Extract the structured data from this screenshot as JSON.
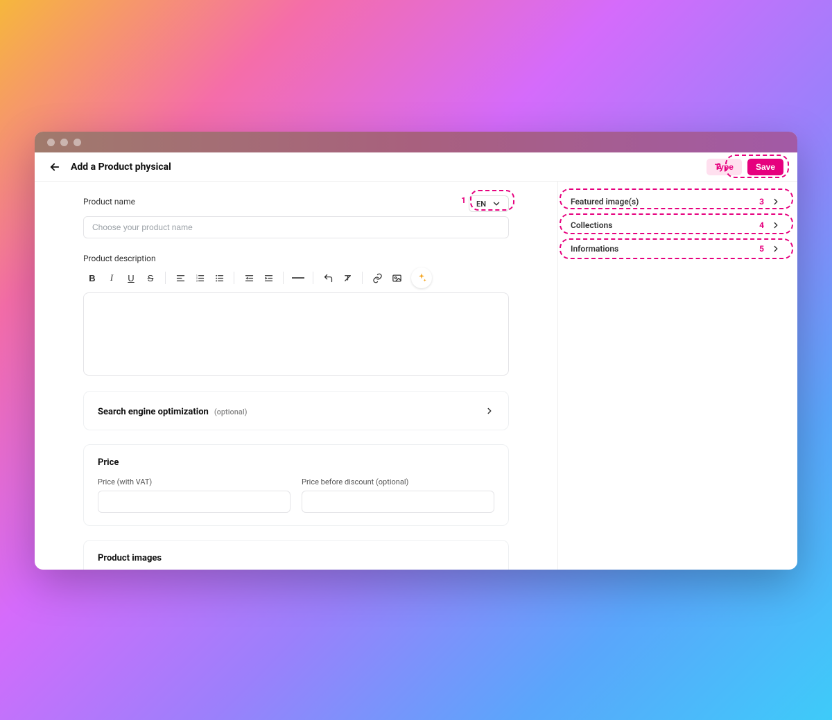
{
  "header": {
    "page_title": "Add a Product physical",
    "type_button": "Type",
    "save_button": "Save"
  },
  "product_name": {
    "label": "Product name",
    "placeholder": "Choose your product name",
    "value": ""
  },
  "language_selector": {
    "current": "EN"
  },
  "product_description": {
    "label": "Product description"
  },
  "seo": {
    "title": "Search engine optimization",
    "optional": "(optional)"
  },
  "price": {
    "title": "Price",
    "with_vat_label": "Price (with VAT)",
    "before_discount_label": "Price before discount (optional)",
    "with_vat_value": "",
    "before_discount_value": ""
  },
  "product_images": {
    "title": "Product images"
  },
  "sidebar": {
    "items": [
      {
        "label": "Featured image(s)"
      },
      {
        "label": "Collections"
      },
      {
        "label": "Informations"
      }
    ]
  },
  "annotations": {
    "n1": "1",
    "n2": "2",
    "n3": "3",
    "n4": "4",
    "n5": "5"
  }
}
